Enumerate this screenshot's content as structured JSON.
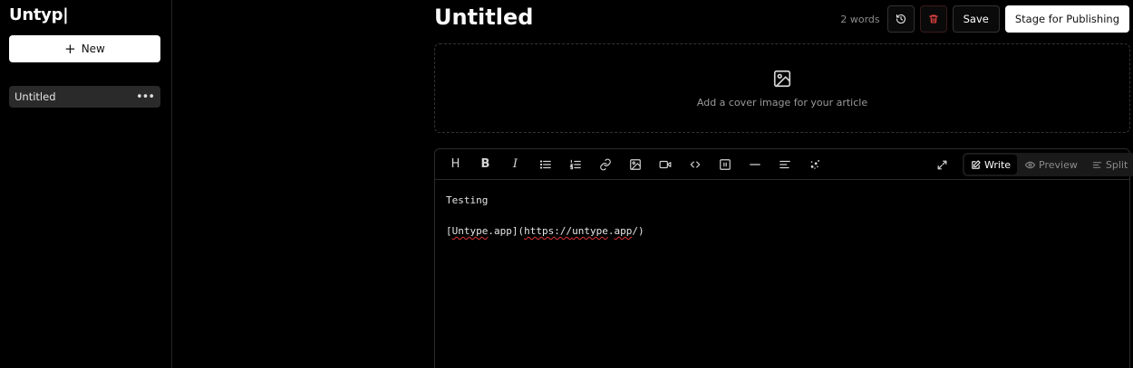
{
  "app": {
    "logo": "Untyp|"
  },
  "sidebar": {
    "new_label": "New",
    "documents": [
      {
        "title": "Untitled"
      }
    ]
  },
  "header": {
    "title": "Untitled",
    "word_count": "2 words",
    "save_label": "Save",
    "stage_label": "Stage for Publishing"
  },
  "cover": {
    "text": "Add a cover image for your article"
  },
  "toolbar": {
    "tools": [
      "heading-icon",
      "bold-icon",
      "italic-icon",
      "bullet-list-icon",
      "numbered-list-icon",
      "link-icon",
      "image-icon",
      "video-icon",
      "code-icon",
      "embed-icon",
      "divider-icon",
      "align-icon",
      "sparkle-icon"
    ],
    "heading_glyph": "H",
    "bold_glyph": "B",
    "italic_glyph": "I"
  },
  "modes": {
    "write": "Write",
    "preview": "Preview",
    "split": "Split",
    "active": "write"
  },
  "editor": {
    "line1": "Testing",
    "line2_bracket_open": "[",
    "line2_link_text_a": "Untype",
    "line2_link_text_b": ".app](",
    "line2_url_a": "https://",
    "line2_url_b": "untype",
    "line2_url_c": ".",
    "line2_url_d": "app",
    "line2_url_e": "/)"
  },
  "colors": {
    "accent": "#ffffff",
    "background": "#000000",
    "danger": "#ef4444"
  }
}
